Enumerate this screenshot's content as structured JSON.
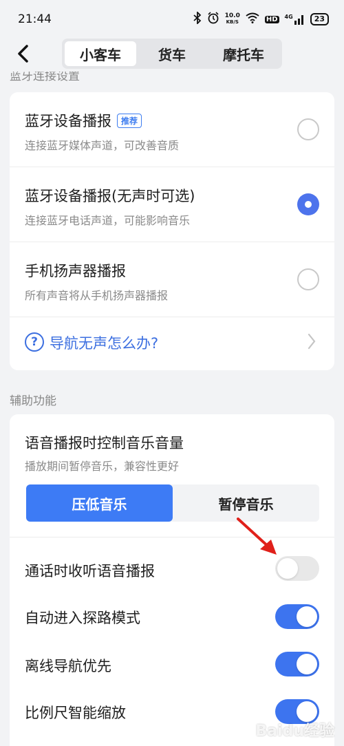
{
  "status_bar": {
    "time": "21:44",
    "net_speed_top": "10.0",
    "net_speed_unit": "KB/S",
    "hd": "HD",
    "signal": "4G",
    "battery": "23"
  },
  "header": {
    "tabs": [
      {
        "label": "小客车",
        "active": true
      },
      {
        "label": "货车",
        "active": false
      },
      {
        "label": "摩托车",
        "active": false
      }
    ]
  },
  "bluetooth_section": {
    "title": "蓝牙连接设置",
    "options": [
      {
        "title": "蓝牙设备播报",
        "badge": "推荐",
        "subtitle": "连接蓝牙媒体声道，可改善音质",
        "selected": false
      },
      {
        "title": "蓝牙设备播报(无声时可选)",
        "subtitle": "连接蓝牙电话声道，可能影响音乐",
        "selected": true
      },
      {
        "title": "手机扬声器播报",
        "subtitle": "所有声音将从手机扬声器播报",
        "selected": false
      }
    ],
    "help_link": "导航无声怎么办?"
  },
  "assist_section": {
    "title": "辅助功能",
    "music_control": {
      "title": "语音播报时控制音乐音量",
      "subtitle": "播放期间暂停音乐，兼容性更好",
      "options": [
        "压低音乐",
        "暂停音乐"
      ],
      "selected": "压低音乐"
    },
    "toggles": [
      {
        "label": "通话时收听语音播报",
        "on": false
      },
      {
        "label": "自动进入探路模式",
        "on": true
      },
      {
        "label": "离线导航优先",
        "on": true
      },
      {
        "label": "比例尺智能缩放",
        "on": true
      }
    ]
  },
  "colors": {
    "accent": "#3d7bf5",
    "arrow": "#e0201a"
  },
  "watermark": "Baidu经验"
}
